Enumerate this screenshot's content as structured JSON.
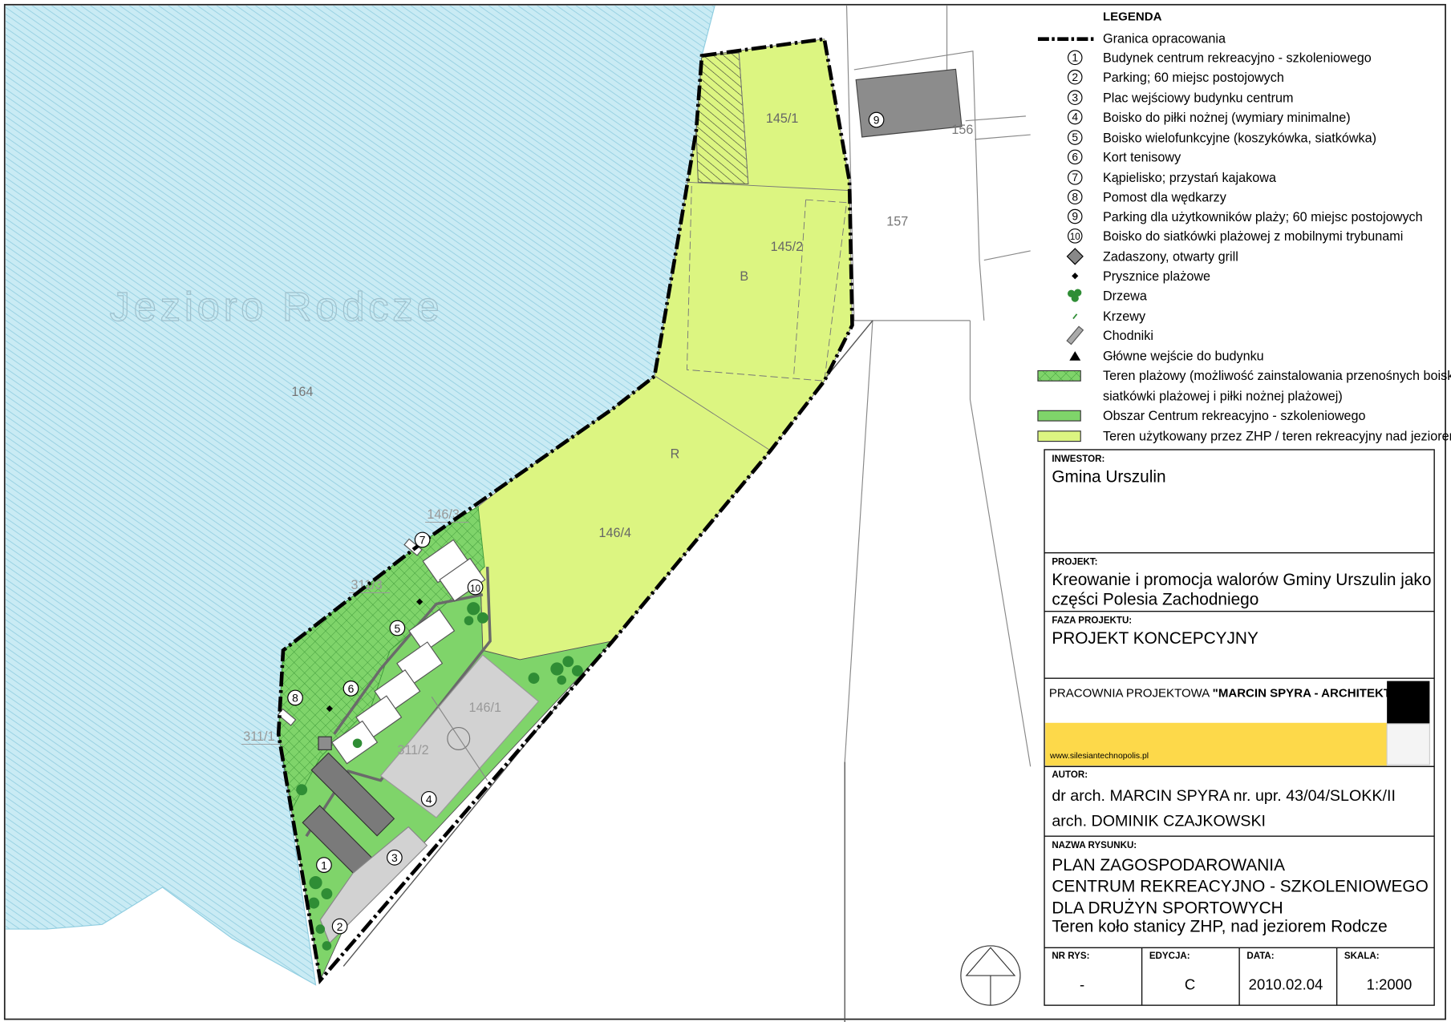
{
  "map": {
    "lake_name": "Jezioro  Rodcze",
    "parcels": {
      "p164": "164",
      "p145_1": "145/1",
      "p145_2": "145/2",
      "p146_4": "146/4",
      "p146_3": "146/3",
      "p146_1": "146/1",
      "p311_3": "311/3",
      "p311_2": "311/2",
      "p311_1": "311/1",
      "p156": "156",
      "p157": "157"
    },
    "zone_labels": {
      "b": "B",
      "r": "R"
    },
    "markers": [
      "1",
      "2",
      "3",
      "4",
      "5",
      "6",
      "7",
      "8",
      "9",
      "10"
    ]
  },
  "legend": {
    "title": "LEGENDA",
    "items": [
      {
        "symbol": "boundary-line",
        "label": "Granica opracowania"
      },
      {
        "symbol": "1",
        "label": "Budynek centrum rekreacyjno - szkoleniowego"
      },
      {
        "symbol": "2",
        "label": "Parking; 60 miejsc postojowych"
      },
      {
        "symbol": "3",
        "label": "Plac wejściowy budynku centrum"
      },
      {
        "symbol": "4",
        "label": "Boisko do piłki nożnej (wymiary minimalne)"
      },
      {
        "symbol": "5",
        "label": "Boisko wielofunkcyjne (koszykówka, siatkówka)"
      },
      {
        "symbol": "6",
        "label": "Kort tenisowy"
      },
      {
        "symbol": "7",
        "label": "Kąpielisko; przystań kajakowa"
      },
      {
        "symbol": "8",
        "label": "Pomost dla wędkarzy"
      },
      {
        "symbol": "9",
        "label": "Parking dla użytkowników plaży; 60 miejsc postojowych"
      },
      {
        "symbol": "10",
        "label": "Boisko do siatkówki plażowej z mobilnymi trybunami"
      },
      {
        "symbol": "grill-icon",
        "label": "Zadaszony, otwarty grill"
      },
      {
        "symbol": "shower-icon",
        "label": "Prysznice plażowe"
      },
      {
        "symbol": "tree-icon",
        "label": "Drzewa"
      },
      {
        "symbol": "shrub-icon",
        "label": "Krzewy"
      },
      {
        "symbol": "path-icon",
        "label": "Chodniki"
      },
      {
        "symbol": "entrance-icon",
        "label": "Główne wejście do budynku"
      },
      {
        "symbol": "beach-swatch",
        "label": "Teren plażowy (możliwość zainstalowania przenośnych boisk do"
      },
      {
        "symbol": "",
        "label": "siatkówki plażowej i piłki nożnej plażowej)"
      },
      {
        "symbol": "green-swatch",
        "label": "Obszar Centrum rekreacyjno - szkoleniowego"
      },
      {
        "symbol": "lime-swatch",
        "label": "Teren użytkowany przez ZHP / teren rekreacyjny nad jeziorem (plaża)"
      }
    ]
  },
  "title_block": {
    "investor_head": "INWESTOR:",
    "investor": "Gmina Urszulin",
    "project_head": "PROJEKT:",
    "project_line1": "Kreowanie i promocja walorów Gminy Urszulin jako",
    "project_line2": "części Polesia Zachodniego",
    "phase_head": "FAZA PROJEKTU:",
    "phase": "PROJEKT KONCEPCYJNY",
    "studio_prefix": "PRACOWNIA PROJEKTOWA ",
    "studio_name": "\"MARCIN SPYRA - ARCHITEKT\"",
    "website": "www.silesiantechnopolis.pl",
    "author_head": "AUTOR:",
    "author1": "dr arch. MARCIN SPYRA nr. upr. 43/04/SLOKK/II",
    "author2": "arch. DOMINIK CZAJKOWSKI",
    "drawing_head": "NAZWA RYSUNKU:",
    "drawing_line1": "PLAN ZAGOSPODAROWANIA",
    "drawing_line2": "CENTRUM REKREACYJNO - SZKOLENIOWEGO",
    "drawing_line3": "DLA DRUŻYN SPORTOWYCH",
    "drawing_line4": "Teren koło stanicy ZHP, nad jeziorem Rodcze",
    "nr_head": "NR RYS:",
    "nr": "-",
    "edition_head": "EDYCJA:",
    "edition": "C",
    "date_head": "DATA:",
    "date": "2010.02.04",
    "scale_head": "SKALA:",
    "scale": "1:2000"
  },
  "colors": {
    "lake": "#c7e9f2",
    "lime": "#dcf581",
    "green": "#7fd46a",
    "accent_yellow": "#fdd94a"
  }
}
